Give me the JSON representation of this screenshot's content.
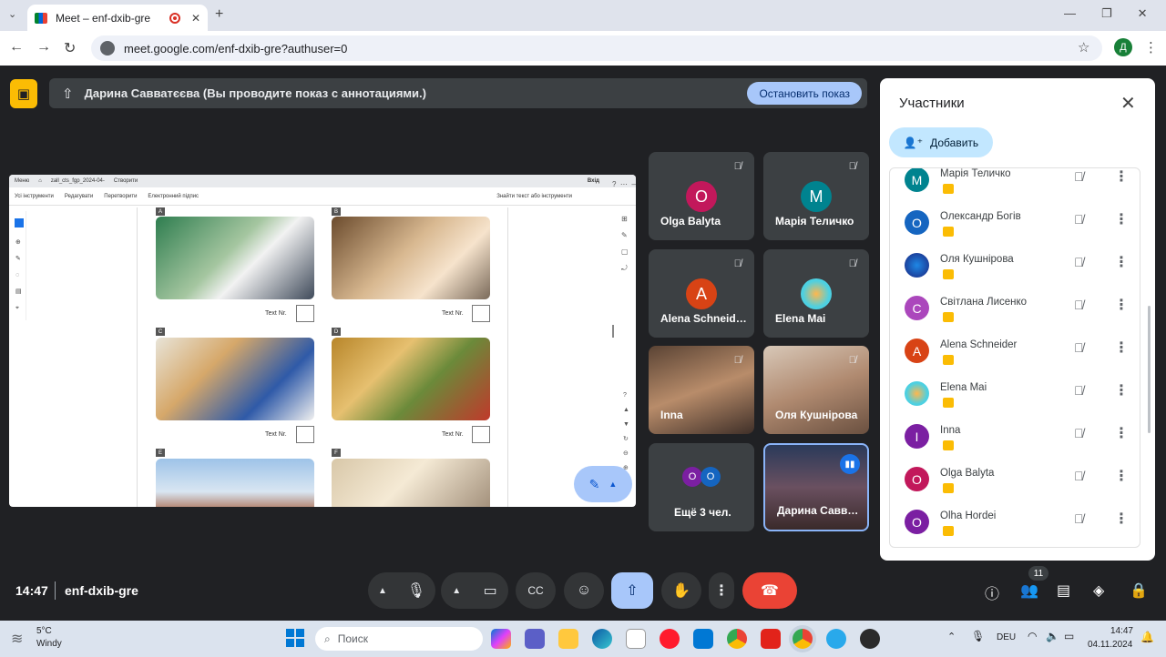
{
  "browser": {
    "tab_title": "Meet – enf-dxib-gre",
    "url": "meet.google.com/enf-dxib-gre?authuser=0",
    "profile_initial": "Д"
  },
  "banner": {
    "text": "Дарина Савватєєва (Вы проводите показ с аннотациями.)",
    "stop_label": "Остановить показ"
  },
  "presentation": {
    "menu_tab": "Меню",
    "doc_tab": "zall_cts_fgp_2024-04-",
    "new_tab": "Створити",
    "exit": "Вхід",
    "toolbar": [
      "Усі інструменти",
      "Редагувати",
      "Перетворити",
      "Електронний підпис"
    ],
    "search": "Знайти текст або інструменти",
    "labels": [
      "A",
      "B",
      "C",
      "D",
      "E",
      "F"
    ],
    "text_nr": "Text Nr."
  },
  "tiles": [
    {
      "name": "Olga Balyta",
      "initial": "O",
      "color": "#c2185b"
    },
    {
      "name": "Марія Теличко",
      "initial": "M",
      "color": "#00838f"
    },
    {
      "name": "Alena Schneid…",
      "initial": "A",
      "color": "#d84315"
    },
    {
      "name": "Elena Mai",
      "initial": "",
      "color": "#4dd0e1"
    },
    {
      "name": "Inna",
      "initial": "",
      "color": "#7a5a48"
    },
    {
      "name": "Оля Кушнірова",
      "initial": "",
      "color": "#8d6e63"
    },
    {
      "name": "Ещё 3 чел.",
      "initial": "",
      "color": "#3c4043"
    },
    {
      "name": "Дарина Савв…",
      "initial": "",
      "color": "#3a4a6a"
    }
  ],
  "more_initials": [
    "O",
    "O"
  ],
  "panel": {
    "title": "Участники",
    "add_label": "Добавить",
    "participants": [
      {
        "name": "Марія Теличко",
        "initial": "M",
        "color": "#00838f"
      },
      {
        "name": "Олександр Богів",
        "initial": "O",
        "color": "#1565c0"
      },
      {
        "name": "Оля Кушнірова",
        "initial": "",
        "color": "#283593"
      },
      {
        "name": "Світлана Лисенко",
        "initial": "C",
        "color": "#ab47bc"
      },
      {
        "name": "Alena Schneider",
        "initial": "A",
        "color": "#d84315"
      },
      {
        "name": "Elena Mai",
        "initial": "",
        "color": "#4dd0e1"
      },
      {
        "name": "Inna",
        "initial": "I",
        "color": "#7b1fa2"
      },
      {
        "name": "Olga Balyta",
        "initial": "O",
        "color": "#c2185b"
      },
      {
        "name": "Olha Hordei",
        "initial": "O",
        "color": "#7b1fa2"
      }
    ]
  },
  "meeting": {
    "time": "14:47",
    "code": "enf-dxib-gre",
    "participant_count": "11"
  },
  "taskbar": {
    "weather_temp": "5°C",
    "weather_text": "Windy",
    "search_placeholder": "Поиск",
    "language": "DEU",
    "clock_time": "14:47",
    "clock_date": "04.11.2024"
  }
}
